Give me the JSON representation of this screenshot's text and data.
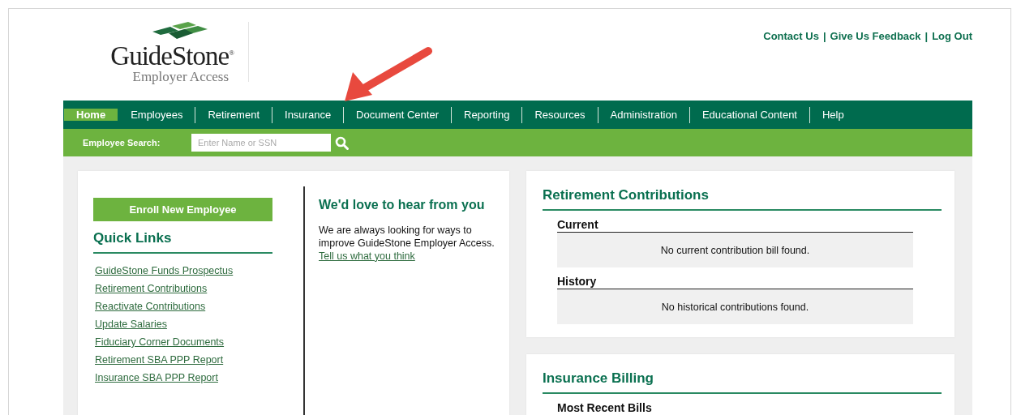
{
  "header": {
    "logo": {
      "name": "GuideStone",
      "mark": "®",
      "subtitle": "Employer Access"
    },
    "top_links": [
      {
        "label": "Contact Us"
      },
      {
        "label": "Give Us Feedback"
      },
      {
        "label": "Log Out"
      }
    ],
    "separator": "|"
  },
  "nav": [
    {
      "label": "Home",
      "selected": true
    },
    {
      "label": "Employees",
      "selected": false
    },
    {
      "label": "Retirement",
      "selected": false
    },
    {
      "label": "Insurance",
      "selected": false
    },
    {
      "label": "Document Center",
      "selected": false
    },
    {
      "label": "Reporting",
      "selected": false
    },
    {
      "label": "Resources",
      "selected": false
    },
    {
      "label": "Administration",
      "selected": false
    },
    {
      "label": "Educational Content",
      "selected": false
    },
    {
      "label": "Help",
      "selected": false
    }
  ],
  "search": {
    "label": "Employee Search:",
    "placeholder": "Enter Name or SSN"
  },
  "left_panel": {
    "button": "Enroll New Employee",
    "title": "Quick Links",
    "links": [
      "GuideStone Funds Prospectus",
      "Retirement Contributions",
      "Reactivate Contributions",
      "Update Salaries",
      "Fiduciary Corner Documents",
      "Retirement SBA PPP Report",
      "Insurance SBA PPP Report"
    ]
  },
  "feedback": {
    "title": "We'd love to hear from you",
    "text": "We are always looking for ways to improve GuideStone Employer Access.",
    "link": "Tell us what you think"
  },
  "retirement": {
    "title": "Retirement Contributions",
    "sections": [
      {
        "heading": "Current",
        "message": "No current contribution bill found."
      },
      {
        "heading": "History",
        "message": "No historical contributions found."
      }
    ]
  },
  "insurance": {
    "title": "Insurance Billing",
    "sections": [
      {
        "heading": "Most Recent Bills"
      }
    ]
  }
}
